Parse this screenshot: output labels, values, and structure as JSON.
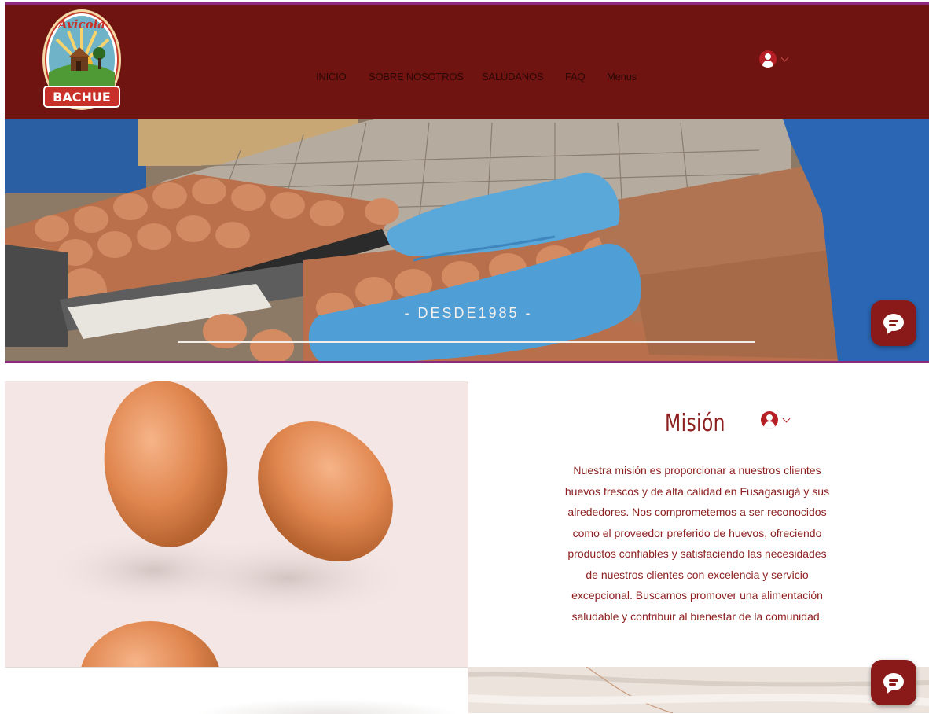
{
  "brand": {
    "logo_script_text": "Avicola",
    "logo_name": "BACHUE"
  },
  "nav": {
    "items": [
      "INICIO",
      "SOBRE NOSOTROS",
      "SALÚDANOS",
      "FAQ",
      "Menus"
    ]
  },
  "account": {
    "icon": "user-avatar-icon",
    "menu_icon": "chevron-down-icon"
  },
  "hero": {
    "tagline": "- DESDE1985 -"
  },
  "chat": {
    "icon": "chat-bubble-icon"
  },
  "mission": {
    "title": "Misión",
    "lines": [
      "Nuestra misión es proporcionar a nuestros clientes",
      "huevos frescos y de alta calidad en Fusagasugá y sus",
      "alrededores. Nos comprometemos a ser reconocidos",
      "como el proveedor preferido de huevos, ofreciendo",
      "productos confiables y satisfaciendo las necesidades",
      "de nuestros clientes con excelencia y servicio",
      "excepcional. Buscamos promover una alimentación",
      "saludable y contribuir al bienestar de la comunidad."
    ]
  },
  "colors": {
    "header_bg": "#6f1410",
    "accent": "#8c2020",
    "divider": "#8e2a7e",
    "chat_button": "#8a1a1a"
  }
}
